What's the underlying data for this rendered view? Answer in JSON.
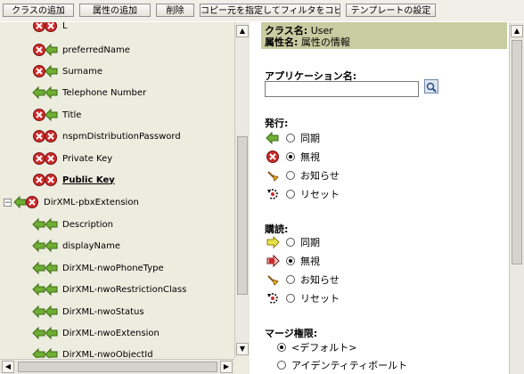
{
  "toolbar": {
    "buttons": [
      "クラスの追加",
      "属性の追加",
      "削除",
      "コピー元を指定してフィルタをコピー...",
      "テンプレートの設定"
    ]
  },
  "tree": {
    "items": [
      {
        "label": "L",
        "icon": "filter-ignore-ignore-icon"
      },
      {
        "label": "preferredName",
        "icon": "filter-ignore-sync-icon"
      },
      {
        "label": "Surname",
        "icon": "filter-ignore-sync-icon"
      },
      {
        "label": "Telephone Number",
        "icon": "filter-sync-sync-icon"
      },
      {
        "label": "Title",
        "icon": "filter-ignore-sync-icon"
      },
      {
        "label": "nspmDistributionPassword",
        "icon": "filter-ignore-ignore-icon"
      },
      {
        "label": "Private Key",
        "icon": "filter-ignore-ignore-icon"
      },
      {
        "label": "Public Key",
        "icon": "filter-ignore-ignore-icon",
        "selected": true
      },
      {
        "label": "DirXML-pbxExtension",
        "icon": "filter-sync-ignore-icon",
        "expander": "−"
      },
      {
        "label": "Description",
        "icon": "filter-sync-sync-icon"
      },
      {
        "label": "displayName",
        "icon": "filter-sync-sync-icon"
      },
      {
        "label": "DirXML-nwoPhoneType",
        "icon": "filter-sync-sync-icon"
      },
      {
        "label": "DirXML-nwoRestrictionClass",
        "icon": "filter-sync-sync-icon"
      },
      {
        "label": "DirXML-nwoStatus",
        "icon": "filter-sync-sync-icon"
      },
      {
        "label": "DirXML-nwoExtension",
        "icon": "filter-sync-sync-icon"
      },
      {
        "label": "DirXML-nwoObjectId",
        "icon": "filter-sync-sync-icon"
      }
    ]
  },
  "details": {
    "class_label": "クラス名:",
    "class_value": "User",
    "attr_label": "属性名:",
    "attr_value": "属性の情報",
    "app_name_label": "アプリケーション名:",
    "app_name_value": "",
    "publish": {
      "label": "発行:",
      "options": [
        {
          "label": "同期",
          "icon": "sync-icon",
          "selected": false
        },
        {
          "label": "無視",
          "icon": "ignore-icon",
          "selected": true
        },
        {
          "label": "お知らせ",
          "icon": "notify-icon",
          "selected": false
        },
        {
          "label": "リセット",
          "icon": "reset-icon",
          "selected": false
        }
      ]
    },
    "subscribe": {
      "label": "購読:",
      "options": [
        {
          "label": "同期",
          "icon": "sync-icon",
          "selected": false
        },
        {
          "label": "無視",
          "icon": "ignore-icon",
          "selected": true
        },
        {
          "label": "お知らせ",
          "icon": "notify-icon",
          "selected": false
        },
        {
          "label": "リセット",
          "icon": "reset-icon",
          "selected": false
        }
      ]
    },
    "merge": {
      "label": "マージ権限:",
      "options": [
        {
          "label": "<デフォルト>",
          "selected": true
        },
        {
          "label": "アイデンティティボールト",
          "selected": false
        }
      ]
    }
  },
  "colors": {
    "sync_green": "#6fae34",
    "ignore_red": "#cc2b2b",
    "header_bg": "#c8cca0",
    "tree_bg": "#ececdf"
  }
}
